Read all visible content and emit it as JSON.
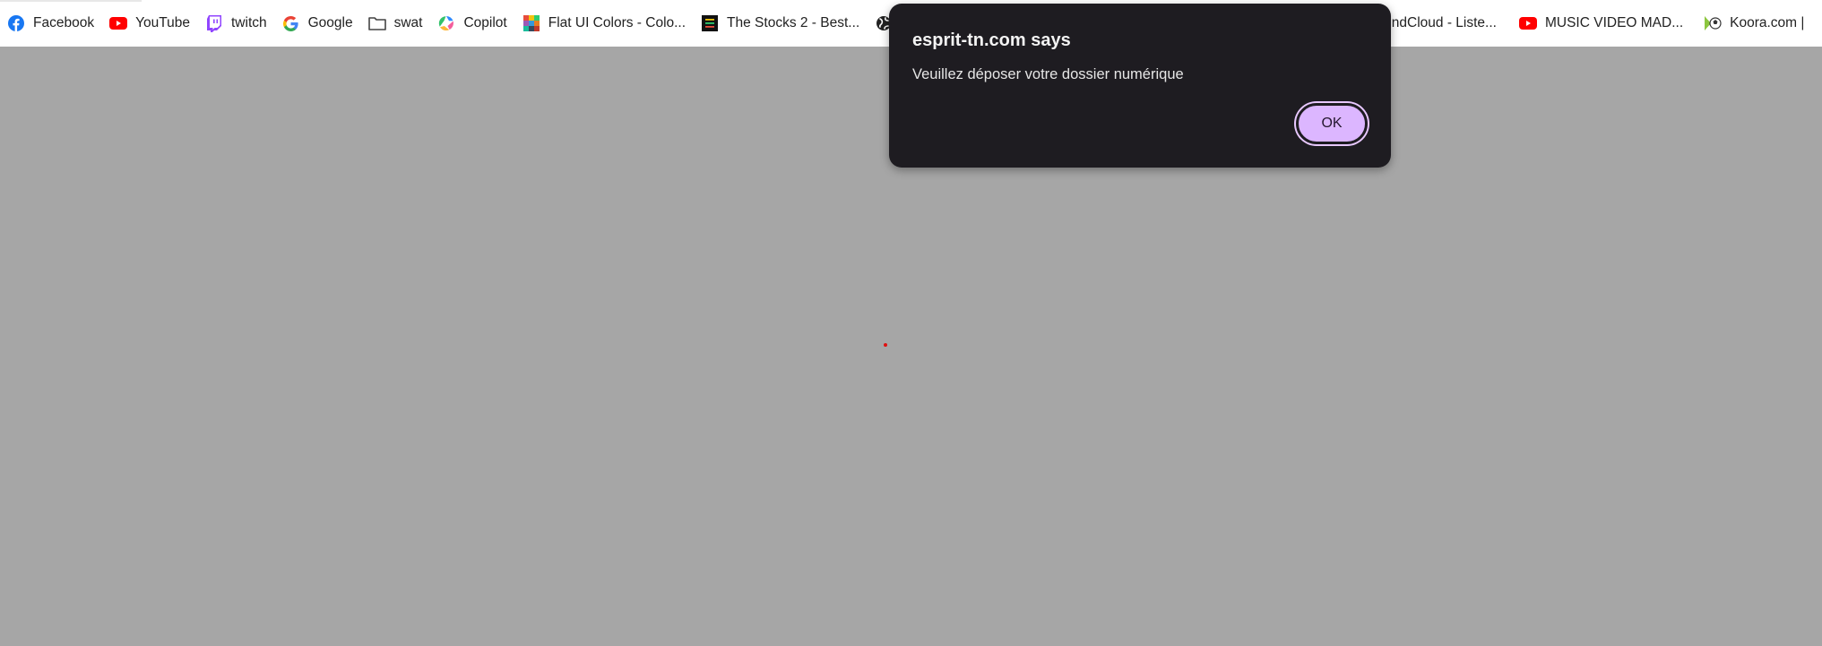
{
  "bookmarks": [
    {
      "label": "Facebook",
      "icon": "facebook-icon"
    },
    {
      "label": "YouTube",
      "icon": "youtube-icon"
    },
    {
      "label": "twitch",
      "icon": "twitch-icon"
    },
    {
      "label": "Google",
      "icon": "google-icon"
    },
    {
      "label": "swat",
      "icon": "folder-icon"
    },
    {
      "label": "Copilot",
      "icon": "copilot-icon"
    },
    {
      "label": "Flat UI Colors - Colo...",
      "icon": "flat-ui-colors-icon"
    },
    {
      "label": "The Stocks 2 - Best...",
      "icon": "the-stocks-icon"
    },
    {
      "label": "",
      "icon": "globe-icon"
    },
    {
      "label": "SoundCloud - Liste...",
      "icon": "soundcloud-icon"
    },
    {
      "label": "MUSIC VIDEO MAD...",
      "icon": "youtube-icon"
    },
    {
      "label": "Koora.com |",
      "icon": "koora-icon"
    }
  ],
  "dialog": {
    "title": "esprit-tn.com says",
    "message": "Veuillez déposer votre dossier numérique",
    "ok_label": "OK"
  },
  "colors": {
    "page_overlay": "#a6a6a6",
    "dialog_background": "#1e1c21",
    "ok_button": "#dcb6ff"
  }
}
